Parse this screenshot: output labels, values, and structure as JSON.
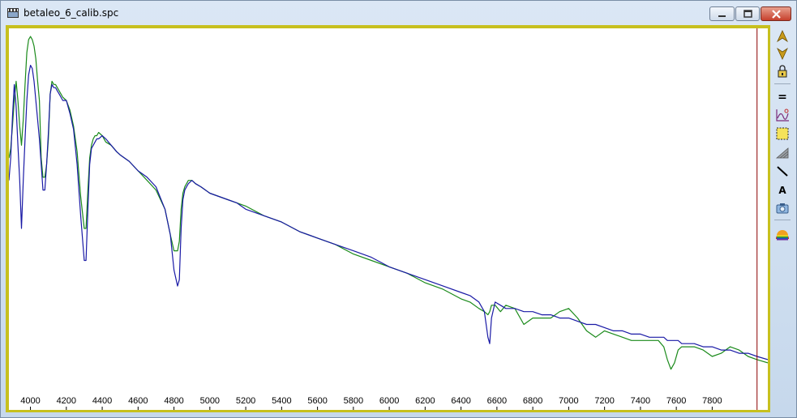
{
  "window": {
    "title": "betaleo_6_calib.spc",
    "controls": [
      "minimize",
      "maximize",
      "close"
    ]
  },
  "toolbar": {
    "icons": [
      "arrow-up-icon",
      "arrow-down-icon",
      "lock-icon",
      "equals-icon",
      "curve-chart-icon",
      "select-rect-icon",
      "gradient-icon",
      "line-tool-icon",
      "text-tool-icon",
      "camera-icon",
      "rainbow-icon"
    ],
    "text_tool_label": "A",
    "equals_label": "="
  },
  "colors": {
    "frame": "#c7c01e",
    "series_reference": "#1a8a1a",
    "series_measured": "#1a1aa6",
    "cursor_line": "#8b0000"
  },
  "chart_data": {
    "type": "line",
    "xlim": [
      3880,
      8110
    ],
    "ylim": [
      0,
      1
    ],
    "x_ticks": [
      4000,
      4200,
      4400,
      4600,
      4800,
      5000,
      5200,
      5400,
      5600,
      5800,
      6000,
      6200,
      6400,
      6600,
      6800,
      7000,
      7200,
      7400,
      7600,
      7800
    ],
    "cursor_x": 8050,
    "series": [
      {
        "color": "#1a8a1a",
        "x": [
          3880,
          3890,
          3900,
          3910,
          3920,
          3930,
          3940,
          3950,
          3960,
          3970,
          3980,
          3990,
          4000,
          4010,
          4020,
          4030,
          4040,
          4050,
          4060,
          4070,
          4080,
          4090,
          4100,
          4110,
          4120,
          4130,
          4140,
          4150,
          4160,
          4170,
          4180,
          4200,
          4220,
          4240,
          4260,
          4280,
          4300,
          4310,
          4320,
          4330,
          4340,
          4350,
          4360,
          4370,
          4380,
          4400,
          4420,
          4450,
          4480,
          4500,
          4550,
          4600,
          4650,
          4700,
          4750,
          4780,
          4800,
          4820,
          4830,
          4840,
          4850,
          4860,
          4870,
          4880,
          4900,
          4920,
          4950,
          5000,
          5050,
          5100,
          5150,
          5200,
          5300,
          5400,
          5500,
          5600,
          5700,
          5800,
          5900,
          6000,
          6100,
          6200,
          6300,
          6400,
          6450,
          6500,
          6530,
          6550,
          6560,
          6570,
          6590,
          6620,
          6650,
          6700,
          6750,
          6800,
          6850,
          6900,
          6950,
          7000,
          7050,
          7100,
          7150,
          7200,
          7250,
          7300,
          7350,
          7400,
          7450,
          7500,
          7530,
          7550,
          7570,
          7590,
          7610,
          7630,
          7650,
          7700,
          7750,
          7800,
          7850,
          7900,
          7950,
          8000,
          8050,
          8110
        ],
        "y": [
          0.62,
          0.65,
          0.72,
          0.8,
          0.86,
          0.8,
          0.72,
          0.66,
          0.74,
          0.85,
          0.95,
          0.99,
          1.0,
          0.99,
          0.97,
          0.93,
          0.86,
          0.8,
          0.62,
          0.56,
          0.56,
          0.6,
          0.68,
          0.82,
          0.86,
          0.85,
          0.85,
          0.84,
          0.83,
          0.82,
          0.81,
          0.8,
          0.77,
          0.72,
          0.64,
          0.5,
          0.4,
          0.4,
          0.52,
          0.62,
          0.66,
          0.68,
          0.69,
          0.69,
          0.7,
          0.69,
          0.67,
          0.66,
          0.64,
          0.63,
          0.61,
          0.58,
          0.55,
          0.52,
          0.46,
          0.38,
          0.33,
          0.33,
          0.36,
          0.46,
          0.51,
          0.53,
          0.54,
          0.55,
          0.55,
          0.54,
          0.53,
          0.51,
          0.5,
          0.49,
          0.48,
          0.47,
          0.44,
          0.42,
          0.39,
          0.37,
          0.35,
          0.32,
          0.3,
          0.28,
          0.26,
          0.23,
          0.21,
          0.18,
          0.17,
          0.15,
          0.14,
          0.13,
          0.14,
          0.16,
          0.16,
          0.14,
          0.16,
          0.15,
          0.1,
          0.12,
          0.12,
          0.12,
          0.14,
          0.15,
          0.12,
          0.08,
          0.06,
          0.08,
          0.07,
          0.06,
          0.05,
          0.05,
          0.05,
          0.05,
          0.03,
          -0.01,
          -0.04,
          -0.02,
          0.02,
          0.03,
          0.03,
          0.03,
          0.02,
          0.0,
          0.01,
          0.03,
          0.02,
          0.0,
          -0.01,
          -0.02
        ]
      },
      {
        "color": "#1a1aa6",
        "x": [
          3880,
          3890,
          3900,
          3910,
          3920,
          3930,
          3940,
          3950,
          3960,
          3970,
          3980,
          3990,
          4000,
          4010,
          4020,
          4030,
          4040,
          4050,
          4060,
          4070,
          4080,
          4090,
          4100,
          4110,
          4120,
          4130,
          4140,
          4150,
          4160,
          4170,
          4180,
          4200,
          4220,
          4240,
          4260,
          4280,
          4300,
          4310,
          4320,
          4330,
          4340,
          4350,
          4360,
          4370,
          4380,
          4400,
          4420,
          4450,
          4480,
          4500,
          4550,
          4600,
          4650,
          4700,
          4750,
          4780,
          4800,
          4820,
          4830,
          4840,
          4850,
          4860,
          4870,
          4880,
          4900,
          4920,
          4950,
          5000,
          5050,
          5100,
          5150,
          5200,
          5300,
          5400,
          5500,
          5600,
          5700,
          5800,
          5900,
          6000,
          6100,
          6200,
          6300,
          6400,
          6450,
          6500,
          6530,
          6550,
          6560,
          6570,
          6590,
          6620,
          6650,
          6700,
          6750,
          6800,
          6850,
          6900,
          6950,
          7000,
          7050,
          7100,
          7150,
          7200,
          7250,
          7300,
          7350,
          7400,
          7450,
          7500,
          7530,
          7550,
          7570,
          7590,
          7610,
          7630,
          7650,
          7700,
          7750,
          7800,
          7850,
          7900,
          7950,
          8000,
          8050,
          8110
        ],
        "y": [
          0.55,
          0.62,
          0.75,
          0.85,
          0.78,
          0.66,
          0.55,
          0.4,
          0.55,
          0.68,
          0.8,
          0.88,
          0.91,
          0.9,
          0.86,
          0.8,
          0.74,
          0.68,
          0.6,
          0.52,
          0.52,
          0.6,
          0.7,
          0.82,
          0.85,
          0.84,
          0.84,
          0.83,
          0.82,
          0.81,
          0.8,
          0.8,
          0.76,
          0.71,
          0.6,
          0.44,
          0.3,
          0.3,
          0.46,
          0.6,
          0.65,
          0.66,
          0.67,
          0.68,
          0.68,
          0.69,
          0.68,
          0.66,
          0.64,
          0.63,
          0.61,
          0.58,
          0.56,
          0.53,
          0.46,
          0.38,
          0.27,
          0.22,
          0.24,
          0.4,
          0.49,
          0.52,
          0.53,
          0.54,
          0.55,
          0.54,
          0.53,
          0.51,
          0.5,
          0.49,
          0.48,
          0.46,
          0.44,
          0.42,
          0.39,
          0.37,
          0.35,
          0.33,
          0.31,
          0.28,
          0.26,
          0.24,
          0.22,
          0.2,
          0.19,
          0.17,
          0.14,
          0.06,
          0.04,
          0.12,
          0.17,
          0.16,
          0.15,
          0.15,
          0.14,
          0.14,
          0.13,
          0.13,
          0.12,
          0.12,
          0.11,
          0.1,
          0.1,
          0.09,
          0.08,
          0.08,
          0.07,
          0.07,
          0.06,
          0.06,
          0.06,
          0.05,
          0.05,
          0.05,
          0.05,
          0.04,
          0.04,
          0.04,
          0.03,
          0.03,
          0.02,
          0.02,
          0.01,
          0.01,
          0.0,
          -0.01
        ]
      }
    ]
  }
}
